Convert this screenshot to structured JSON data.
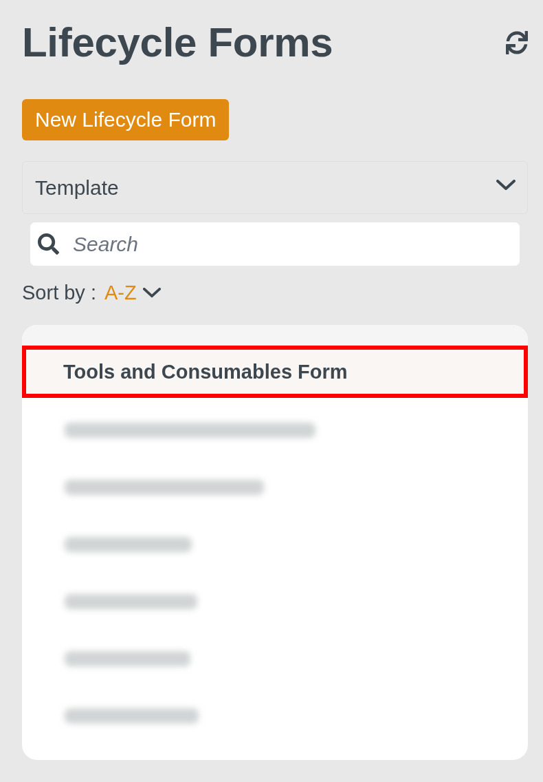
{
  "header": {
    "title": "Lifecycle Forms"
  },
  "new_button": {
    "label": "New Lifecycle Form"
  },
  "template_dropdown": {
    "value": "Template"
  },
  "search": {
    "placeholder": "Search"
  },
  "sort": {
    "label": "Sort by :",
    "value": "A-Z"
  },
  "list": {
    "items": [
      {
        "kind": "entry",
        "label": "Tools and Consumables Form",
        "selected": true,
        "outlined": true
      },
      {
        "kind": "blurred",
        "selected": false,
        "outlined": false
      },
      {
        "kind": "blurred",
        "selected": false,
        "outlined": false
      },
      {
        "kind": "blurred",
        "selected": false,
        "outlined": false
      },
      {
        "kind": "blurred",
        "selected": false,
        "outlined": false
      },
      {
        "kind": "blurred",
        "selected": false,
        "outlined": false
      },
      {
        "kind": "blurred",
        "selected": false,
        "outlined": false
      }
    ]
  }
}
